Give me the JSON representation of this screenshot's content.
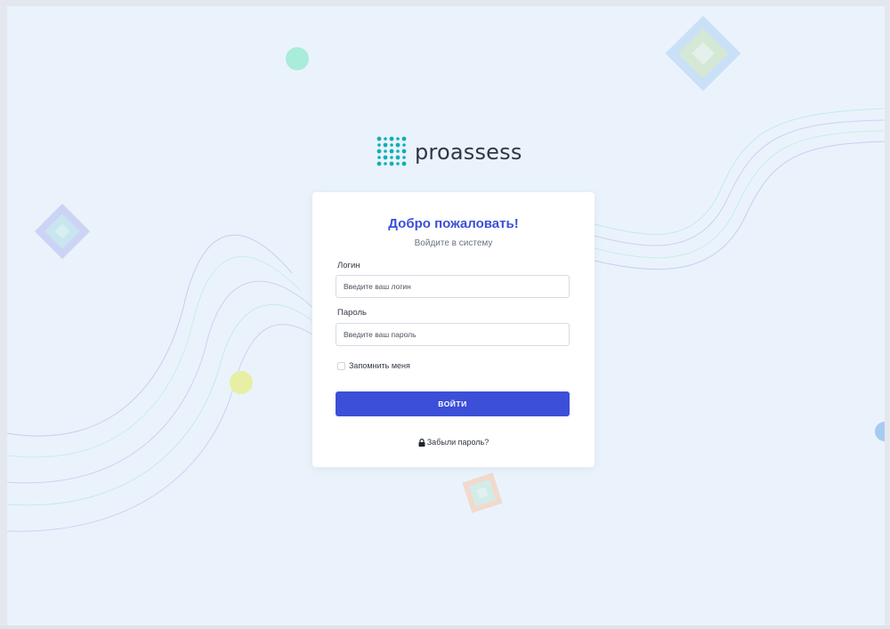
{
  "brand": {
    "name": "proassess",
    "accent": "#3b4fd8",
    "logo_color": "#0fb0b6"
  },
  "login_card": {
    "title": "Добро пожаловать!",
    "subtitle": "Войдите в систему",
    "login_label": "Логин",
    "login_placeholder": "Введите ваш логин",
    "password_label": "Пароль",
    "password_placeholder": "Введите ваш пароль",
    "remember_label": "Запомнить меня",
    "submit_label": "ВОЙТИ",
    "forgot_label": "Забыли пароль?",
    "forgot_icon": "lock-icon"
  }
}
